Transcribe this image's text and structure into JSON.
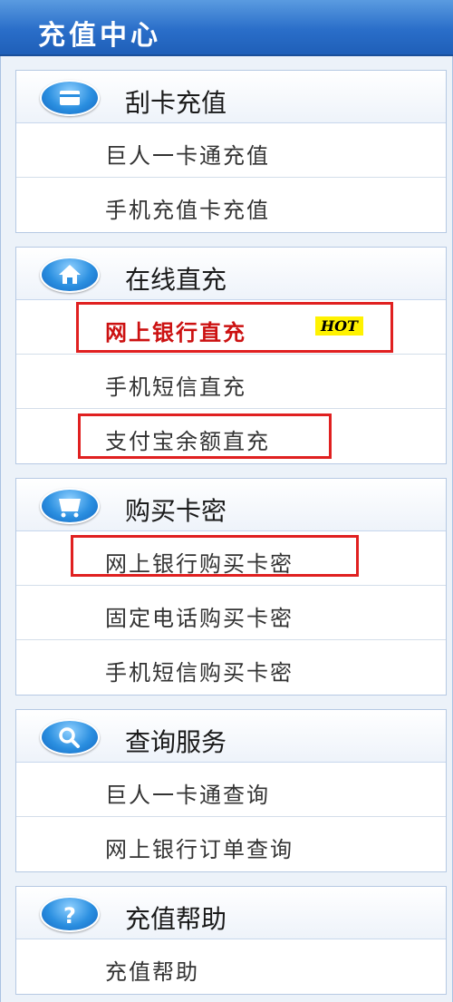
{
  "header": {
    "title": "充值中心"
  },
  "colors": {
    "accent": "#2a6ec9",
    "hot_text": "#cc1111",
    "highlight_box": "#e02020",
    "hot_badge_bg": "#fff200"
  },
  "sections": [
    {
      "title": "刮卡充值",
      "icon": "card-icon",
      "items": [
        {
          "label": "巨人一卡通充值"
        },
        {
          "label": "手机充值卡充值"
        }
      ]
    },
    {
      "title": "在线直充",
      "icon": "home-icon",
      "items": [
        {
          "label": "网上银行直充",
          "badge": "HOT",
          "highlighted": true
        },
        {
          "label": "手机短信直充"
        },
        {
          "label": "支付宝余额直充",
          "highlighted": true
        }
      ]
    },
    {
      "title": "购买卡密",
      "icon": "cart-icon",
      "items": [
        {
          "label": "网上银行购买卡密",
          "highlighted": true
        },
        {
          "label": "固定电话购买卡密"
        },
        {
          "label": "手机短信购买卡密"
        }
      ]
    },
    {
      "title": "查询服务",
      "icon": "search-icon",
      "items": [
        {
          "label": "巨人一卡通查询"
        },
        {
          "label": "网上银行订单查询"
        }
      ]
    },
    {
      "title": "充值帮助",
      "icon": "help-icon",
      "items": [
        {
          "label": "充值帮助"
        }
      ]
    }
  ]
}
